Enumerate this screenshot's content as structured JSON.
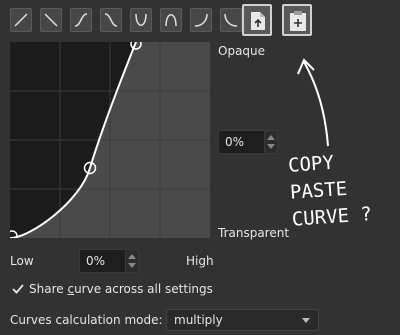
{
  "presets": [
    {
      "icon": "linear-up-curve-icon"
    },
    {
      "icon": "linear-down-curve-icon"
    },
    {
      "icon": "s-curve-icon"
    },
    {
      "icon": "inverse-s-curve-icon"
    },
    {
      "icon": "u-curve-icon"
    },
    {
      "icon": "arch-curve-icon"
    },
    {
      "icon": "ease-in-curve-icon"
    },
    {
      "icon": "ease-out-curve-icon"
    }
  ],
  "clipboard": {
    "copy_icon": "copy-curve-icon",
    "paste_icon": "paste-curve-icon"
  },
  "labels": {
    "opaque": "Opaque",
    "transparent": "Transparent",
    "low": "Low",
    "high": "High"
  },
  "opaque_value": "0%",
  "range_value": "0%",
  "share_curve": {
    "checked": true,
    "label_pre": "Share ",
    "label_underlined": "c",
    "label_post": "urve across all settings"
  },
  "calc_mode": {
    "label": "Curves calculation mode:",
    "value": "multiply"
  },
  "annotation": {
    "lines": [
      "COPY",
      "PASTE",
      "CURVE ?"
    ]
  },
  "colors": {
    "background": "#323232",
    "curve_fill": "#1b1b1b",
    "curve_bg": "#4a4a4a",
    "curve_line": "#ffffff"
  }
}
